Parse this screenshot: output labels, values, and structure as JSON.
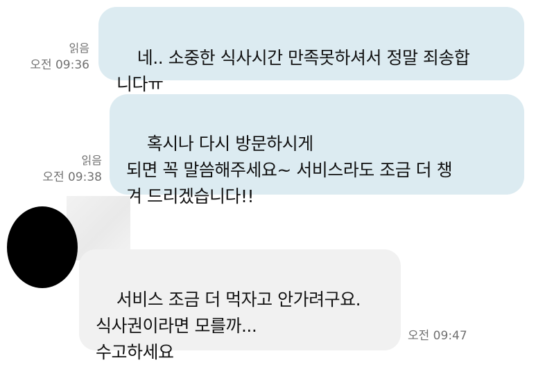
{
  "messages": [
    {
      "direction": "outgoing",
      "text": "네.. 소중한 식사시간 만족못하셔서 정말 죄송합\n니다ㅠ",
      "read_label": "읽음",
      "time": "오전 09:36"
    },
    {
      "direction": "outgoing",
      "text": "혹시나 다시 방문하시게\n되면 꼭 말씀해주세요~ 서비스라도 조금 더 챙\n겨 드리겠습니다!!",
      "read_label": "읽음",
      "time": "오전 09:38"
    },
    {
      "direction": "incoming",
      "text": "서비스 조금 더 먹자고 안가려구요.\n식사권이라면 모를까...\n수고하세요",
      "time": "오전 09:47"
    }
  ],
  "colors": {
    "outgoing_bubble": "#dcebf1",
    "incoming_bubble": "#f1f1f1",
    "meta_text": "#707070"
  }
}
